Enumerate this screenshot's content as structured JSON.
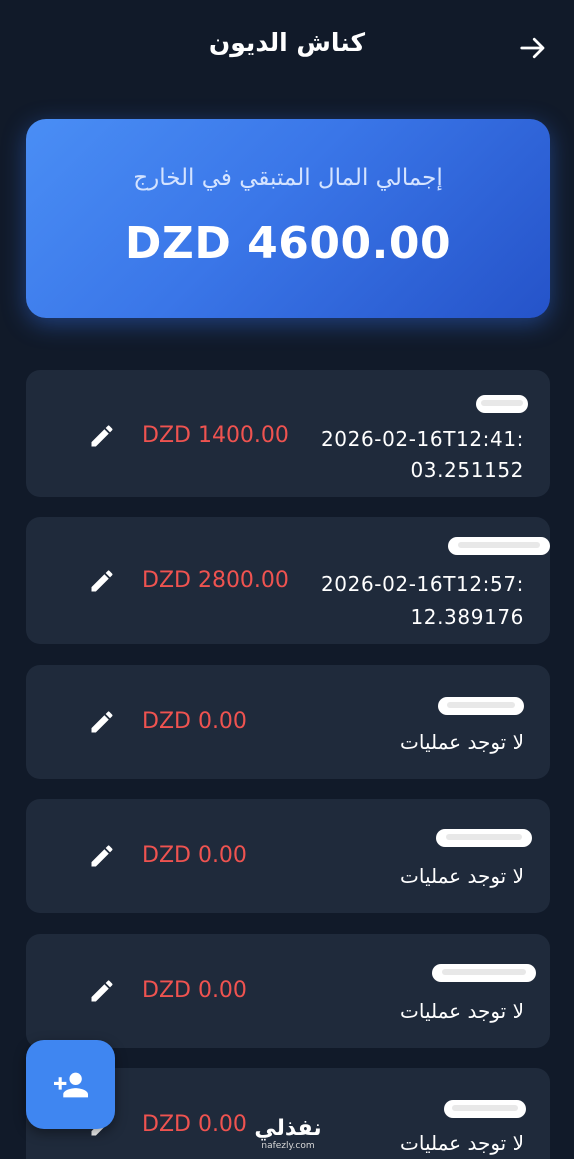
{
  "header": {
    "title": "كناش الديون"
  },
  "summary": {
    "label": "إجمالي المال المتبقي في الخارج",
    "amount": "DZD 4600.00"
  },
  "debtors": [
    {
      "date_line1": "2026-02-16T12:41:",
      "date_line2": "03.251152",
      "amount": "DZD 1400.00"
    },
    {
      "date_line1": "2026-02-16T12:57:",
      "date_line2": "12.389176",
      "amount": "DZD 2800.00"
    },
    {
      "status": "لا توجد عمليات",
      "amount": "DZD 0.00"
    },
    {
      "status": "لا توجد عمليات",
      "amount": "DZD 0.00"
    },
    {
      "status": "لا توجد عمليات",
      "amount": "DZD 0.00"
    },
    {
      "status": "لا توجد عمليات",
      "amount": "DZD 0.00"
    }
  ],
  "watermark": {
    "text": "نفذلي",
    "url": "nafezly.com"
  },
  "icons": {
    "back": "arrow-right-icon",
    "edit": "pencil-icon",
    "add_person": "person-add-icon"
  },
  "colors": {
    "background": "#111a29",
    "card": "#1f2a3b",
    "accent": "#3f86f1",
    "debt_amount": "#ef5350"
  }
}
